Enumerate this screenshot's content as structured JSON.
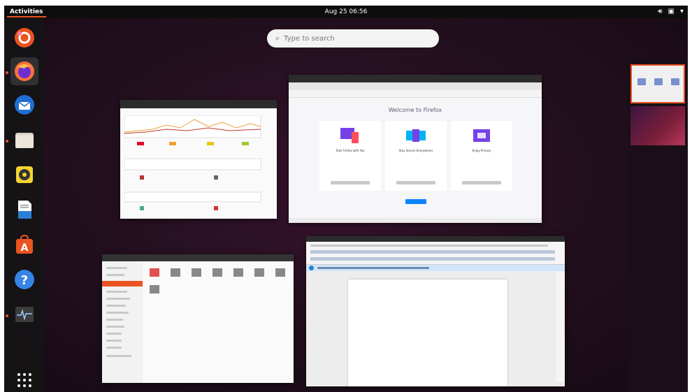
{
  "topbar": {
    "activities_label": "Activities",
    "clock": "Aug 25  06:56"
  },
  "search": {
    "placeholder": "Type to search"
  },
  "firefox_window": {
    "welcome_title": "Welcome to Firefox",
    "cards": [
      "Take Firefox with You",
      "Stay Secure Everywhere",
      "Enjoy Privacy"
    ]
  },
  "dock": {
    "items": [
      "ubuntu-software-icon",
      "firefox-icon",
      "thunderbird-icon",
      "files-icon",
      "rhythmbox-icon",
      "libreoffice-writer-icon",
      "app-center-icon",
      "help-icon",
      "system-monitor-icon",
      "show-apps-icon"
    ]
  },
  "colors": {
    "accent": "#e95420",
    "background": "#24101f",
    "dock": "#141414"
  }
}
